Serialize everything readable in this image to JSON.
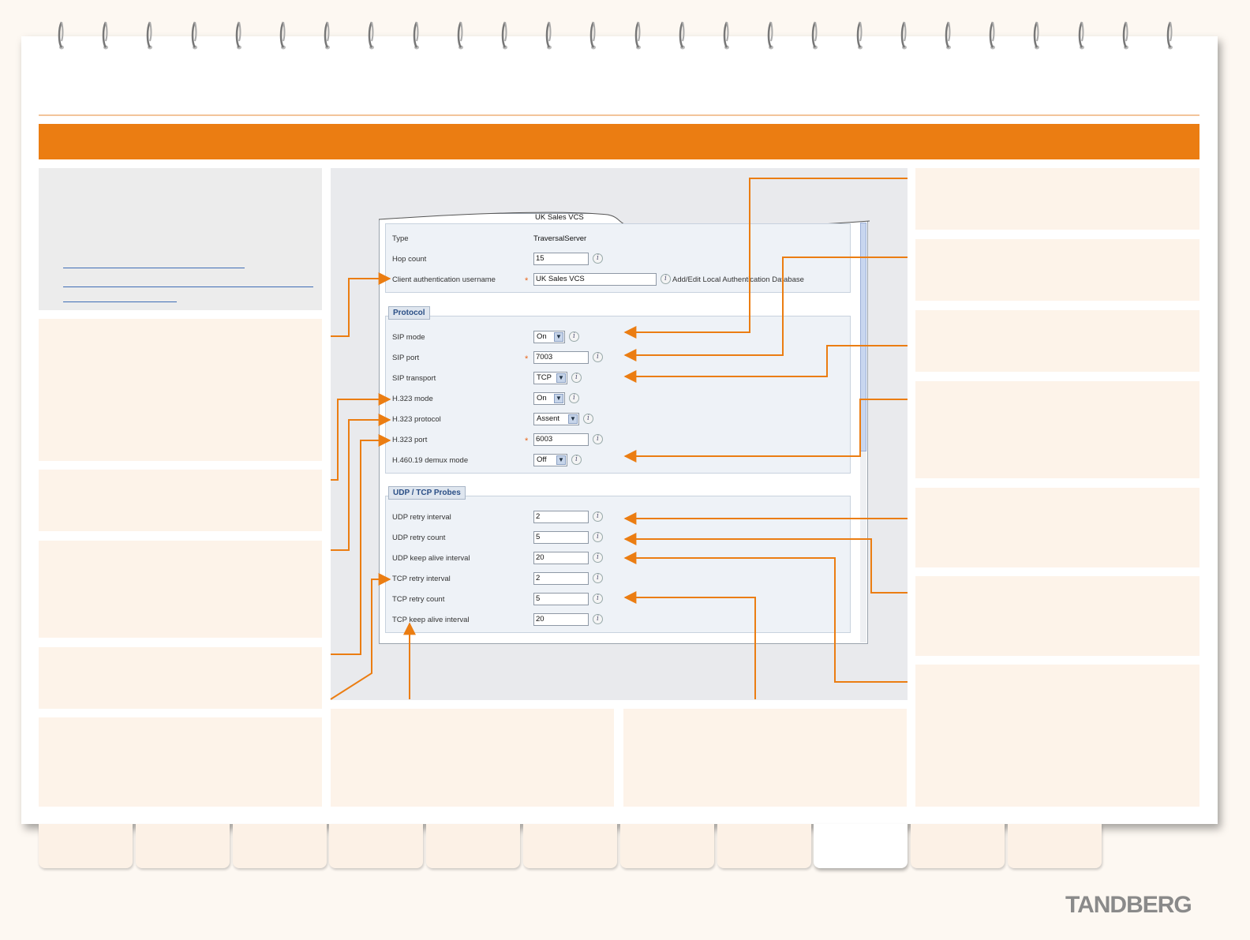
{
  "form": {
    "name_value": "UK Sales VCS",
    "type_label": "Type",
    "type_value": "TraversalServer",
    "hop_count_label": "Hop count",
    "hop_count_value": "15",
    "client_auth_label": "Client authentication username",
    "client_auth_value": "UK Sales VCS",
    "auth_db_link": "Add/Edit Local Authentication Database",
    "protocol_title": "Protocol",
    "protocol": [
      {
        "label": "SIP mode",
        "kind": "select",
        "value": "On",
        "required": false
      },
      {
        "label": "SIP port",
        "kind": "input",
        "value": "7003",
        "required": true
      },
      {
        "label": "SIP transport",
        "kind": "select",
        "value": "TCP",
        "required": false
      },
      {
        "label": "H.323 mode",
        "kind": "select",
        "value": "On",
        "required": false
      },
      {
        "label": "H.323 protocol",
        "kind": "select",
        "value": "Assent",
        "required": false
      },
      {
        "label": "H.323 port",
        "kind": "input",
        "value": "6003",
        "required": true
      },
      {
        "label": "H.460.19 demux mode",
        "kind": "select",
        "value": "Off",
        "required": false
      }
    ],
    "probes_title": "UDP / TCP Probes",
    "probes": [
      {
        "label": "UDP retry interval",
        "value": "2"
      },
      {
        "label": "UDP retry count",
        "value": "5"
      },
      {
        "label": "UDP keep alive interval",
        "value": "20"
      },
      {
        "label": "TCP retry interval",
        "value": "2"
      },
      {
        "label": "TCP retry count",
        "value": "5"
      },
      {
        "label": "TCP keep alive interval",
        "value": "20"
      }
    ],
    "info_glyph": "i",
    "required_glyph": "*",
    "dropdown_glyph": "▼"
  },
  "brand": {
    "logo": "TANDBERG"
  },
  "colors": {
    "accent": "#eb7d12",
    "panel": "#fdf3e9",
    "link": "#3f6db6"
  }
}
